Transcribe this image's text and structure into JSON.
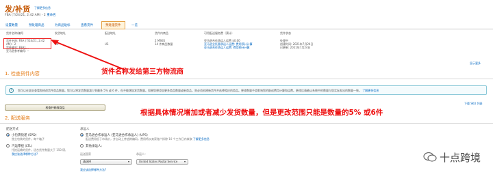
{
  "header": {
    "title": "发/补货",
    "learn_more": "了解更多信息",
    "subtitle": "FBA (7/24/21, 2:42 AM) - 2",
    "rename": "重命名"
  },
  "tabs": [
    {
      "label": "设置数量"
    },
    {
      "label": "预处理商品"
    },
    {
      "label": "为商品贴标"
    },
    {
      "label": "查看货件"
    },
    {
      "label": "预处理货件"
    },
    {
      "label": "一览"
    }
  ],
  "info": {
    "col1_head": "货件名称/编号",
    "col1_lines": [
      "货件名称: FBA (7/24/21, 2:42",
      "AM) - 2",
      "货件编号: FBA1..."
    ],
    "col1_extra": "亚马逊参考编号: --",
    "col2_head": "发货地址",
    "col2_lines": [
      "",
      "",
      "US",
      " "
    ],
    "col3_head": "配送地址",
    "col3_lines": [
      "",
      "",
      "US"
    ],
    "col4_head": "货件内商品",
    "col4_lines": [
      "2 MSKU",
      "14 件商品数量"
    ],
    "col5_head": "可用配送服务费（预计）",
    "col5_lines": [
      "亚马逊合作承运人运费 $0.00",
      "亚马逊全托管承运人运费: 费用预计计算",
      "亚马逊合作承运人运费: 费用预计计算"
    ],
    "col6_head": "货件状态",
    "col6_lines": [
      "处理中",
      "创建时间: 2021年7月24日",
      "已更新: 2021年7月24日"
    ],
    "help_link": "显示更多"
  },
  "annotations": {
    "ann1": "货件名称发给第三方物流商",
    "ann2": "根据具体情况增加或者减少发货数量，但是更改范围只能是数量的5% 或6件"
  },
  "sections": {
    "s1": "1. 检查货件内容",
    "s2": "2. 配送服务"
  },
  "alert": {
    "icon": "i",
    "text": "您可以在此处查看和修改货件商品数量。您可以将发货数量减少到最多 5% 或 6 件，但不能增加发货数量。如果您想添加更多商品数量或新商品，则必须创建新货件并选择相应的商品。更改数量不会影响您的配送费用计算和运费。更改后请确认系统中的数量与您实际发出的数量一致。",
    "link": "了解更多信息"
  },
  "review_button": "检查并修改商品",
  "right_link2": "下载 SKU 列表",
  "shipping": {
    "method_label": "配送方式",
    "opt1": "小包裹快递 (SPD)",
    "opt1_sub": "独立包装的货件，每个箱子",
    "opt2": "汽运零担 (LTL)",
    "opt2_sub": "托拍运输的货件，适合货件数量大于 150 磅,",
    "opt2_sub2": "我应该选择哪种方法?",
    "carrier_label": "承运人",
    "c1": "亚马逊合作承运人 (亚马逊合作承运人) (UPS)",
    "c1_sub": "配送费用低于市场价，并自动上传追踪编码，费用将从卖家账户扣除 10 个工作日内收取",
    "c1_link": "了解更多信息",
    "c2": "其他承运人：",
    "c2_sub": "其他承运人",
    "country_label": "运送国家",
    "carrier_select_label": "承运人：",
    "country_value": "请选择",
    "carrier_value": "United States Postal Service",
    "help_link": "我应该选择哪种方法?"
  },
  "watermark": {
    "text": "十点跨境"
  }
}
